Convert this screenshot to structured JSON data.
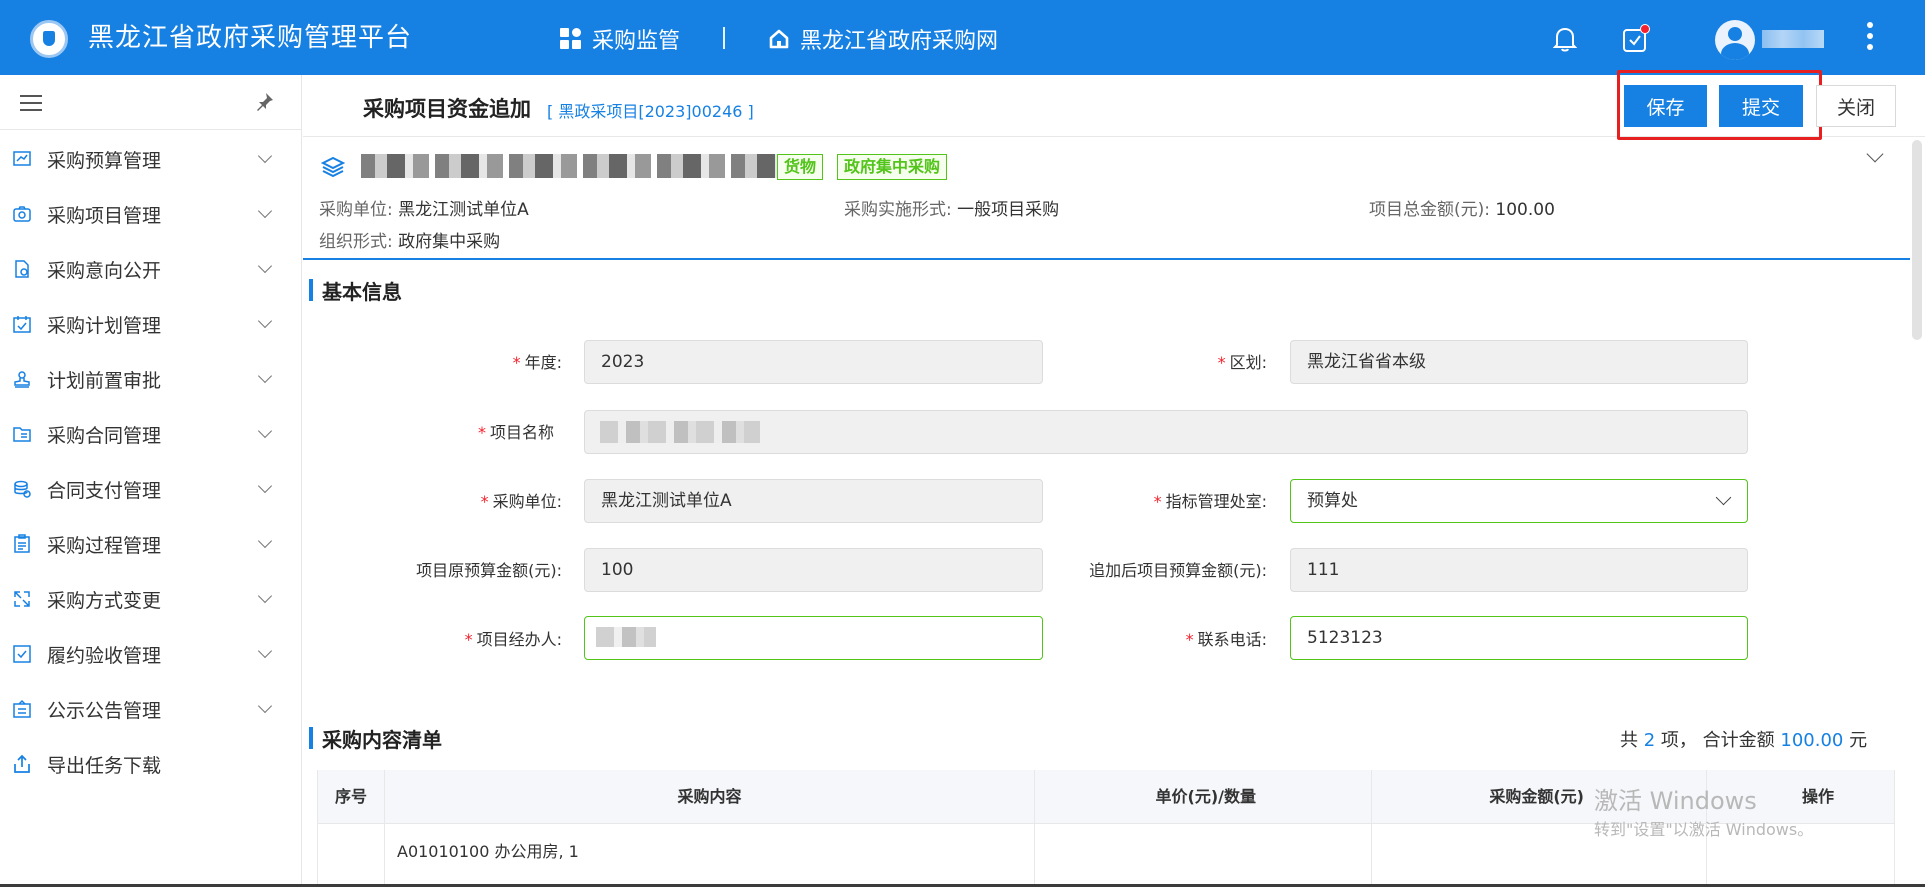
{
  "header": {
    "brand": "黑龙江省政府采购管理平台",
    "nav": [
      {
        "label": "采购监管",
        "icon": "grid-icon"
      },
      {
        "label": "黑龙江省政府采购网",
        "icon": "home-icon"
      }
    ],
    "has_notification": true
  },
  "sidebar": {
    "items": [
      {
        "label": "采购预算管理",
        "icon": "chart-icon",
        "expandable": true
      },
      {
        "label": "采购项目管理",
        "icon": "camera-icon",
        "expandable": true
      },
      {
        "label": "采购意向公开",
        "icon": "document-icon",
        "expandable": true
      },
      {
        "label": "采购计划管理",
        "icon": "calendar-icon",
        "expandable": true
      },
      {
        "label": "计划前置审批",
        "icon": "stamp-icon",
        "expandable": true
      },
      {
        "label": "采购合同管理",
        "icon": "folder-icon",
        "expandable": true
      },
      {
        "label": "合同支付管理",
        "icon": "coins-icon",
        "expandable": true
      },
      {
        "label": "采购过程管理",
        "icon": "clipboard-icon",
        "expandable": true
      },
      {
        "label": "采购方式变更",
        "icon": "switch-icon",
        "expandable": true
      },
      {
        "label": "履约验收管理",
        "icon": "checkbox-icon",
        "expandable": true
      },
      {
        "label": "公示公告管理",
        "icon": "board-icon",
        "expandable": true
      },
      {
        "label": "导出任务下载",
        "icon": "upload-icon",
        "expandable": false
      }
    ]
  },
  "page": {
    "title": "采购项目资金追加",
    "code": "[ 黑政采项目[2023]00246 ]",
    "buttons": {
      "save": "保存",
      "submit": "提交",
      "close": "关闭"
    }
  },
  "summary": {
    "tags": [
      "货物",
      "政府集中采购"
    ],
    "fields": [
      {
        "key": "采购单位:",
        "value": "黑龙江测试单位A"
      },
      {
        "key": "采购实施形式:",
        "value": "一般项目采购"
      },
      {
        "key": "项目总金额(元):",
        "value": "100.00"
      },
      {
        "key": "组织形式:",
        "value": "政府集中采购"
      }
    ]
  },
  "basic": {
    "heading": "基本信息",
    "year": {
      "label": "年度:",
      "value": "2023"
    },
    "region": {
      "label": "区划:",
      "value": "黑龙江省省本级"
    },
    "project_name": {
      "label": "项目名称"
    },
    "unit": {
      "label": "采购单位:",
      "value": "黑龙江测试单位A"
    },
    "office": {
      "label": "指标管理处室:",
      "value": "预算处"
    },
    "orig_budget": {
      "label": "项目原预算金额(元):",
      "value": "100"
    },
    "new_budget": {
      "label": "追加后项目预算金额(元):",
      "value": "111"
    },
    "manager": {
      "label": "项目经办人:"
    },
    "phone": {
      "label": "联系电话:",
      "value": "5123123"
    }
  },
  "list": {
    "heading": "采购内容清单",
    "summary": {
      "prefix": "共",
      "count": "2",
      "mid": "项， 合计金额",
      "total": "100.00",
      "suffix": "元"
    },
    "columns": [
      "序号",
      "采购内容",
      "单价(元)/数量",
      "采购金额(元)",
      "操作"
    ],
    "rows": [
      {
        "content": "A01010100 办公用房, 1"
      }
    ]
  },
  "watermark": {
    "line1": "激活 Windows",
    "line2": "转到\"设置\"以激活 Windows。"
  }
}
